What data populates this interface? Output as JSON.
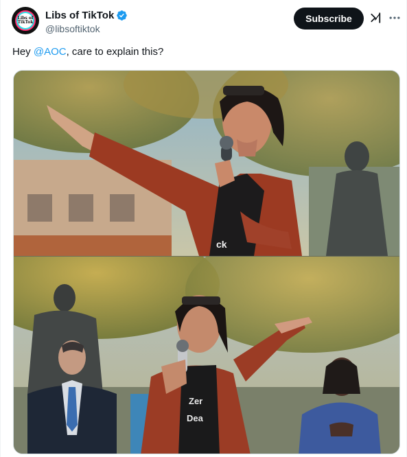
{
  "author": {
    "display_name": "Libs of TikTok",
    "handle": "@libsoftiktok",
    "avatar_text_line1": "Libs of",
    "avatar_text_line2": "TikTok",
    "verified": true
  },
  "actions": {
    "subscribe_label": "Subscribe",
    "grok_icon": "grok-icon",
    "more_icon": "more-icon"
  },
  "tweet": {
    "text_before": "Hey ",
    "mention": "@AOC",
    "text_after": ", care to explain this?"
  },
  "media": {
    "photo_count": 2
  },
  "colors": {
    "accent": "#1d9bf0",
    "text": "#0f1419",
    "secondary_text": "#536471",
    "subscribe_bg": "#0f1419"
  }
}
